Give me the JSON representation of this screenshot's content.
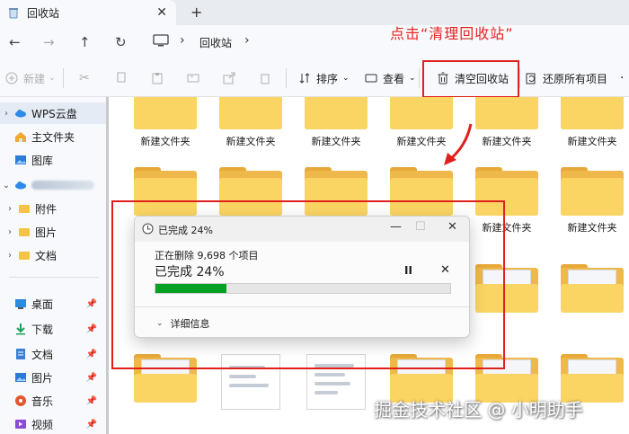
{
  "tab": {
    "title": "回收站"
  },
  "address": {
    "crumb": "回收站"
  },
  "annotation": {
    "text": "点击“清理回收站”"
  },
  "toolbar": {
    "new_label": "新建",
    "sort_label": "排序",
    "view_label": "查看",
    "empty_bin_label": "清空回收站",
    "restore_all_label": "还原所有项目"
  },
  "sidebar": {
    "items": [
      {
        "label": "WPS云盘"
      },
      {
        "label": "主文件夹"
      },
      {
        "label": "图库"
      },
      {
        "label": ""
      },
      {
        "label": "附件"
      },
      {
        "label": "图片"
      },
      {
        "label": "文档"
      },
      {
        "label": "桌面"
      },
      {
        "label": "下载"
      },
      {
        "label": "文档"
      },
      {
        "label": "图片"
      },
      {
        "label": "音乐"
      },
      {
        "label": "视频"
      }
    ]
  },
  "content": {
    "folder_name": "新建文件夹",
    "names": [
      "新建文件夹",
      "新建文件夹",
      "新建文件夹",
      "新建文件夹",
      "新建文件夹",
      "新建文件夹",
      "新建文件夹",
      "新建文件夹"
    ]
  },
  "dialog": {
    "title": "已完成 24%",
    "description": "正在删除 9,698 个项目",
    "progress_text": "已完成 24%",
    "progress_percent": 24,
    "details_label": "详细信息",
    "pause_icon": "pause-icon",
    "cancel_icon": "close-icon"
  },
  "watermark": {
    "text": "掘金技术社区 @ 小明助手"
  },
  "colors": {
    "annotation_red": "#e0201c",
    "progress_green": "#06a124",
    "folder_yellow": "#fbd563"
  }
}
